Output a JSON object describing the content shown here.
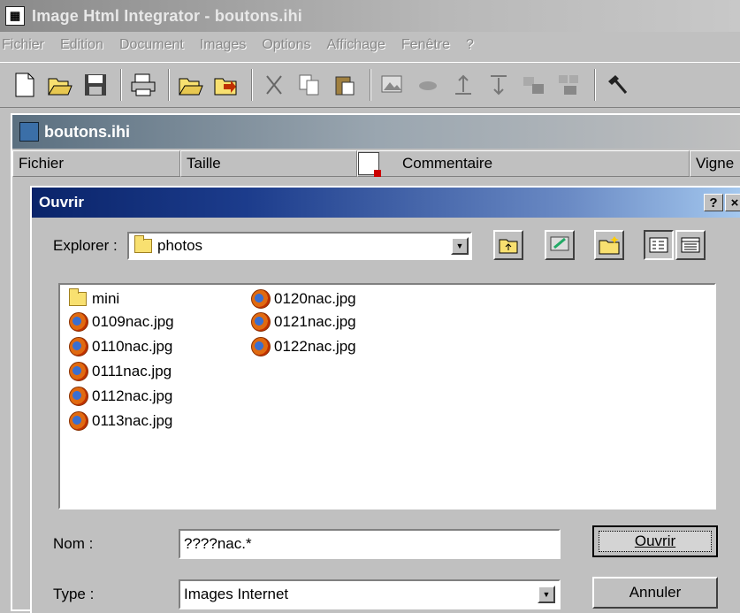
{
  "app": {
    "title": "Image Html Integrator - boutons.ihi"
  },
  "menu": [
    "Fichier",
    "Edition",
    "Document",
    "Images",
    "Options",
    "Affichage",
    "Fenêtre",
    "?"
  ],
  "toolbar_icons": [
    "new-icon",
    "open-icon",
    "save-icon",
    "print-icon",
    "open-folder-icon",
    "import-icon",
    "cut-icon",
    "copy-icon",
    "paste-icon",
    "image-icon",
    "link-icon",
    "move-up-icon",
    "move-down-icon",
    "generate-icon",
    "generate-all-icon",
    "tool-icon"
  ],
  "document": {
    "title": "boutons.ihi",
    "columns": [
      "Fichier",
      "Taille",
      "Commentaire",
      "Vigne"
    ]
  },
  "dialog": {
    "title": "Ouvrir",
    "help_label": "?",
    "close_label": "×",
    "look_in_label": "Explorer :",
    "look_in_value": "photos",
    "files": [
      "mini",
      "0109nac.jpg",
      "0110nac.jpg",
      "0111nac.jpg",
      "0112nac.jpg",
      "0113nac.jpg",
      "0120nac.jpg",
      "0121nac.jpg",
      "0122nac.jpg"
    ],
    "name_label": "Nom :",
    "name_value": "????nac.*",
    "type_label": "Type :",
    "type_value": "Images Internet",
    "open_button": "Ouvrir",
    "cancel_button": "Annuler"
  }
}
